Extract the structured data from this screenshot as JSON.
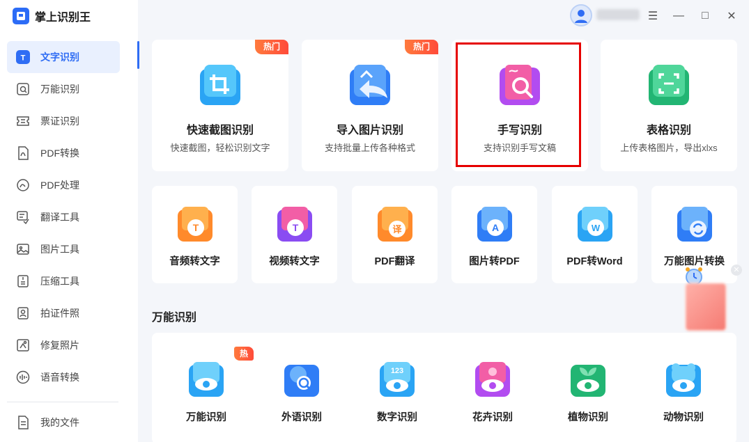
{
  "app": {
    "title": "掌上识别王"
  },
  "sidebar": {
    "items": [
      {
        "label": "文字识别",
        "icon": "text-recognition-icon",
        "active": true
      },
      {
        "label": "万能识别",
        "icon": "universal-scan-icon"
      },
      {
        "label": "票证识别",
        "icon": "ticket-icon"
      },
      {
        "label": "PDF转换",
        "icon": "pdf-convert-icon"
      },
      {
        "label": "PDF处理",
        "icon": "pdf-process-icon"
      },
      {
        "label": "翻译工具",
        "icon": "translate-icon"
      },
      {
        "label": "图片工具",
        "icon": "image-tool-icon"
      },
      {
        "label": "压缩工具",
        "icon": "compress-icon"
      },
      {
        "label": "拍证件照",
        "icon": "id-photo-icon"
      },
      {
        "label": "修复照片",
        "icon": "repair-photo-icon"
      },
      {
        "label": "语音转换",
        "icon": "voice-convert-icon"
      }
    ],
    "my_files": "我的文件"
  },
  "badges": {
    "hot": "热门"
  },
  "top_cards": [
    {
      "title": "快速截图识别",
      "subtitle": "快速截图，轻松识别文字",
      "hot": true,
      "color": "#2aa4f4"
    },
    {
      "title": "导入图片识别",
      "subtitle": "支持批量上传各种格式",
      "hot": true,
      "color": "#2f7df6"
    },
    {
      "title": "手写识别",
      "subtitle": "支持识别手写文稿",
      "hot": false,
      "color": "#b24cf0"
    },
    {
      "title": "表格识别",
      "subtitle": "上传表格图片，导出xlxs",
      "hot": false,
      "color": "#22b573"
    }
  ],
  "mid_cards": [
    {
      "title": "音频转文字",
      "color": "#ff8a2b",
      "glyph": "T"
    },
    {
      "title": "视频转文字",
      "color": "#8a4cf2",
      "glyph": "T"
    },
    {
      "title": "PDF翻译",
      "color": "#ff8a2b",
      "glyph": "译"
    },
    {
      "title": "图片转PDF",
      "color": "#2f7df6",
      "glyph": "A"
    },
    {
      "title": "PDF转Word",
      "color": "#2aa4f4",
      "glyph": "W"
    },
    {
      "title": "万能图片转换",
      "color": "#2f7df6",
      "glyph": "⟳"
    }
  ],
  "section": {
    "universal_title": "万能识别"
  },
  "bottom_items": [
    {
      "title": "万能识别",
      "color": "#2aa4f4",
      "hot": true
    },
    {
      "title": "外语识别",
      "color": "#2f7df6",
      "hot": false
    },
    {
      "title": "数字识别",
      "color": "#2aa4f4",
      "hot": false,
      "glyph": "123"
    },
    {
      "title": "花卉识别",
      "color": "#b24cf0",
      "hot": false
    },
    {
      "title": "植物识别",
      "color": "#22b573",
      "hot": false
    },
    {
      "title": "动物识别",
      "color": "#2aa4f4",
      "hot": false
    }
  ],
  "window": {
    "minimize": "—",
    "maximize": "□",
    "close": "✕",
    "menu": "☰"
  }
}
